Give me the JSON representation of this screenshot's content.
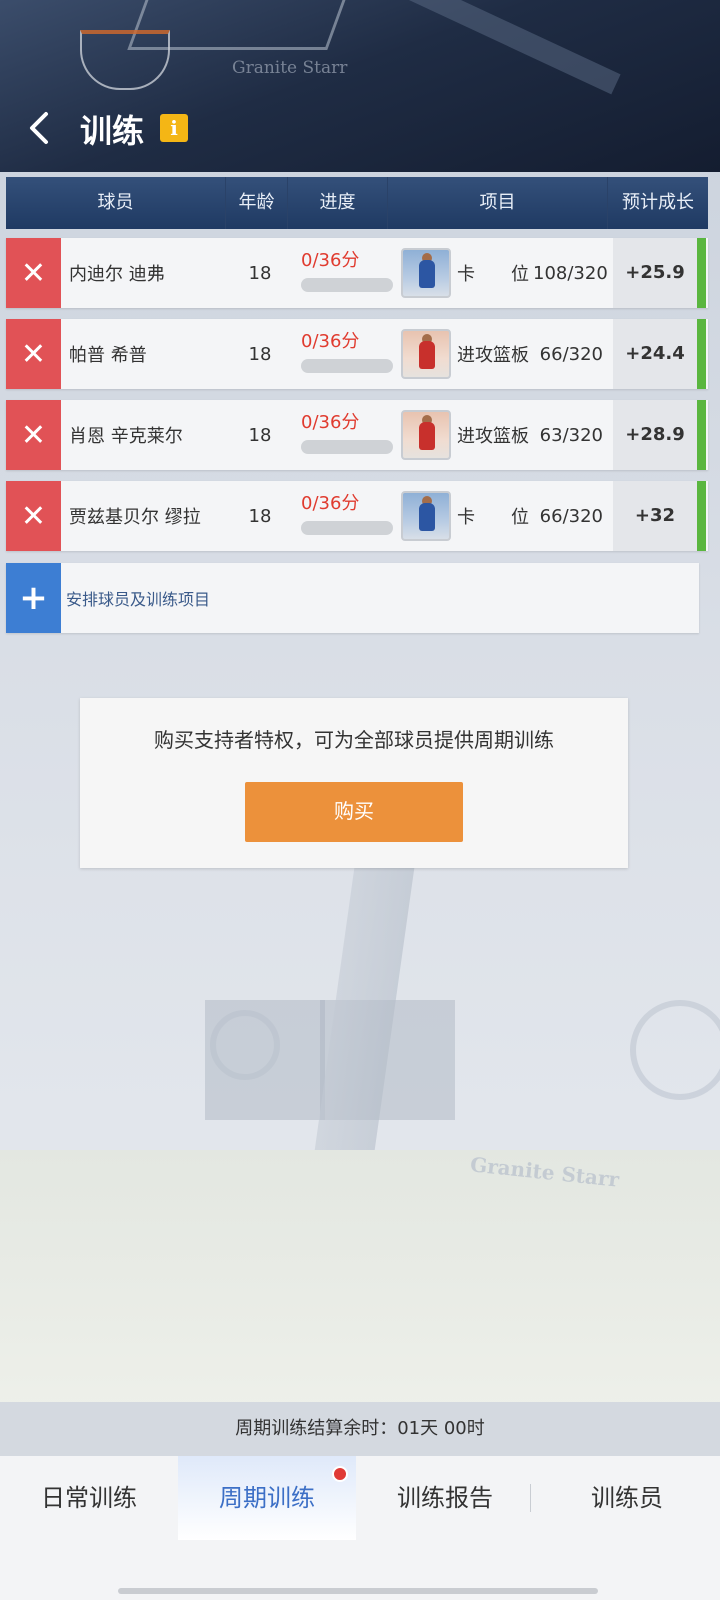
{
  "header": {
    "title": "训练",
    "back_icon": "chevron-left-icon",
    "info_icon": "info-icon",
    "info_glyph": "i",
    "bg_watermark": "Granite Starr"
  },
  "table": {
    "columns": [
      "球员",
      "年龄",
      "进度",
      "项目",
      "预计成长"
    ],
    "rows": [
      {
        "name": "内迪尔 迪弗",
        "age": "18",
        "progress": "0/36分",
        "progress_fraction": 0,
        "thumb": "blue",
        "skill": "卡　　位",
        "score": "108/320",
        "growth": "+25.9"
      },
      {
        "name": "帕普 希普",
        "age": "18",
        "progress": "0/36分",
        "progress_fraction": 0,
        "thumb": "red",
        "skill": "进攻篮板",
        "score": "66/320",
        "growth": "+24.4"
      },
      {
        "name": "肖恩 辛克莱尔",
        "age": "18",
        "progress": "0/36分",
        "progress_fraction": 0,
        "thumb": "red",
        "skill": "进攻篮板",
        "score": "63/320",
        "growth": "+28.9"
      },
      {
        "name": "贾兹基贝尔 缪拉",
        "age": "18",
        "progress": "0/36分",
        "progress_fraction": 0,
        "thumb": "blue",
        "skill": "卡　　位",
        "score": "66/320",
        "growth": "+32"
      }
    ],
    "add_label": "安排球员及训练项目"
  },
  "promo": {
    "message": "购买支持者特权，可为全部球员提供周期训练",
    "button": "购买"
  },
  "footer": {
    "countdown": "周期训练结算余时：01天 00时",
    "tabs": [
      "日常训练",
      "周期训练",
      "训练报告",
      "训练员"
    ],
    "active_tab": 1
  },
  "colors": {
    "delete": "#e15256",
    "add": "#3d7ed3",
    "buy": "#ec913b",
    "header_bar": "#1f3a63",
    "progress_text": "#e03b2f",
    "growth_edge": "#5ab63f",
    "active_tab_text": "#3c6fc6"
  }
}
